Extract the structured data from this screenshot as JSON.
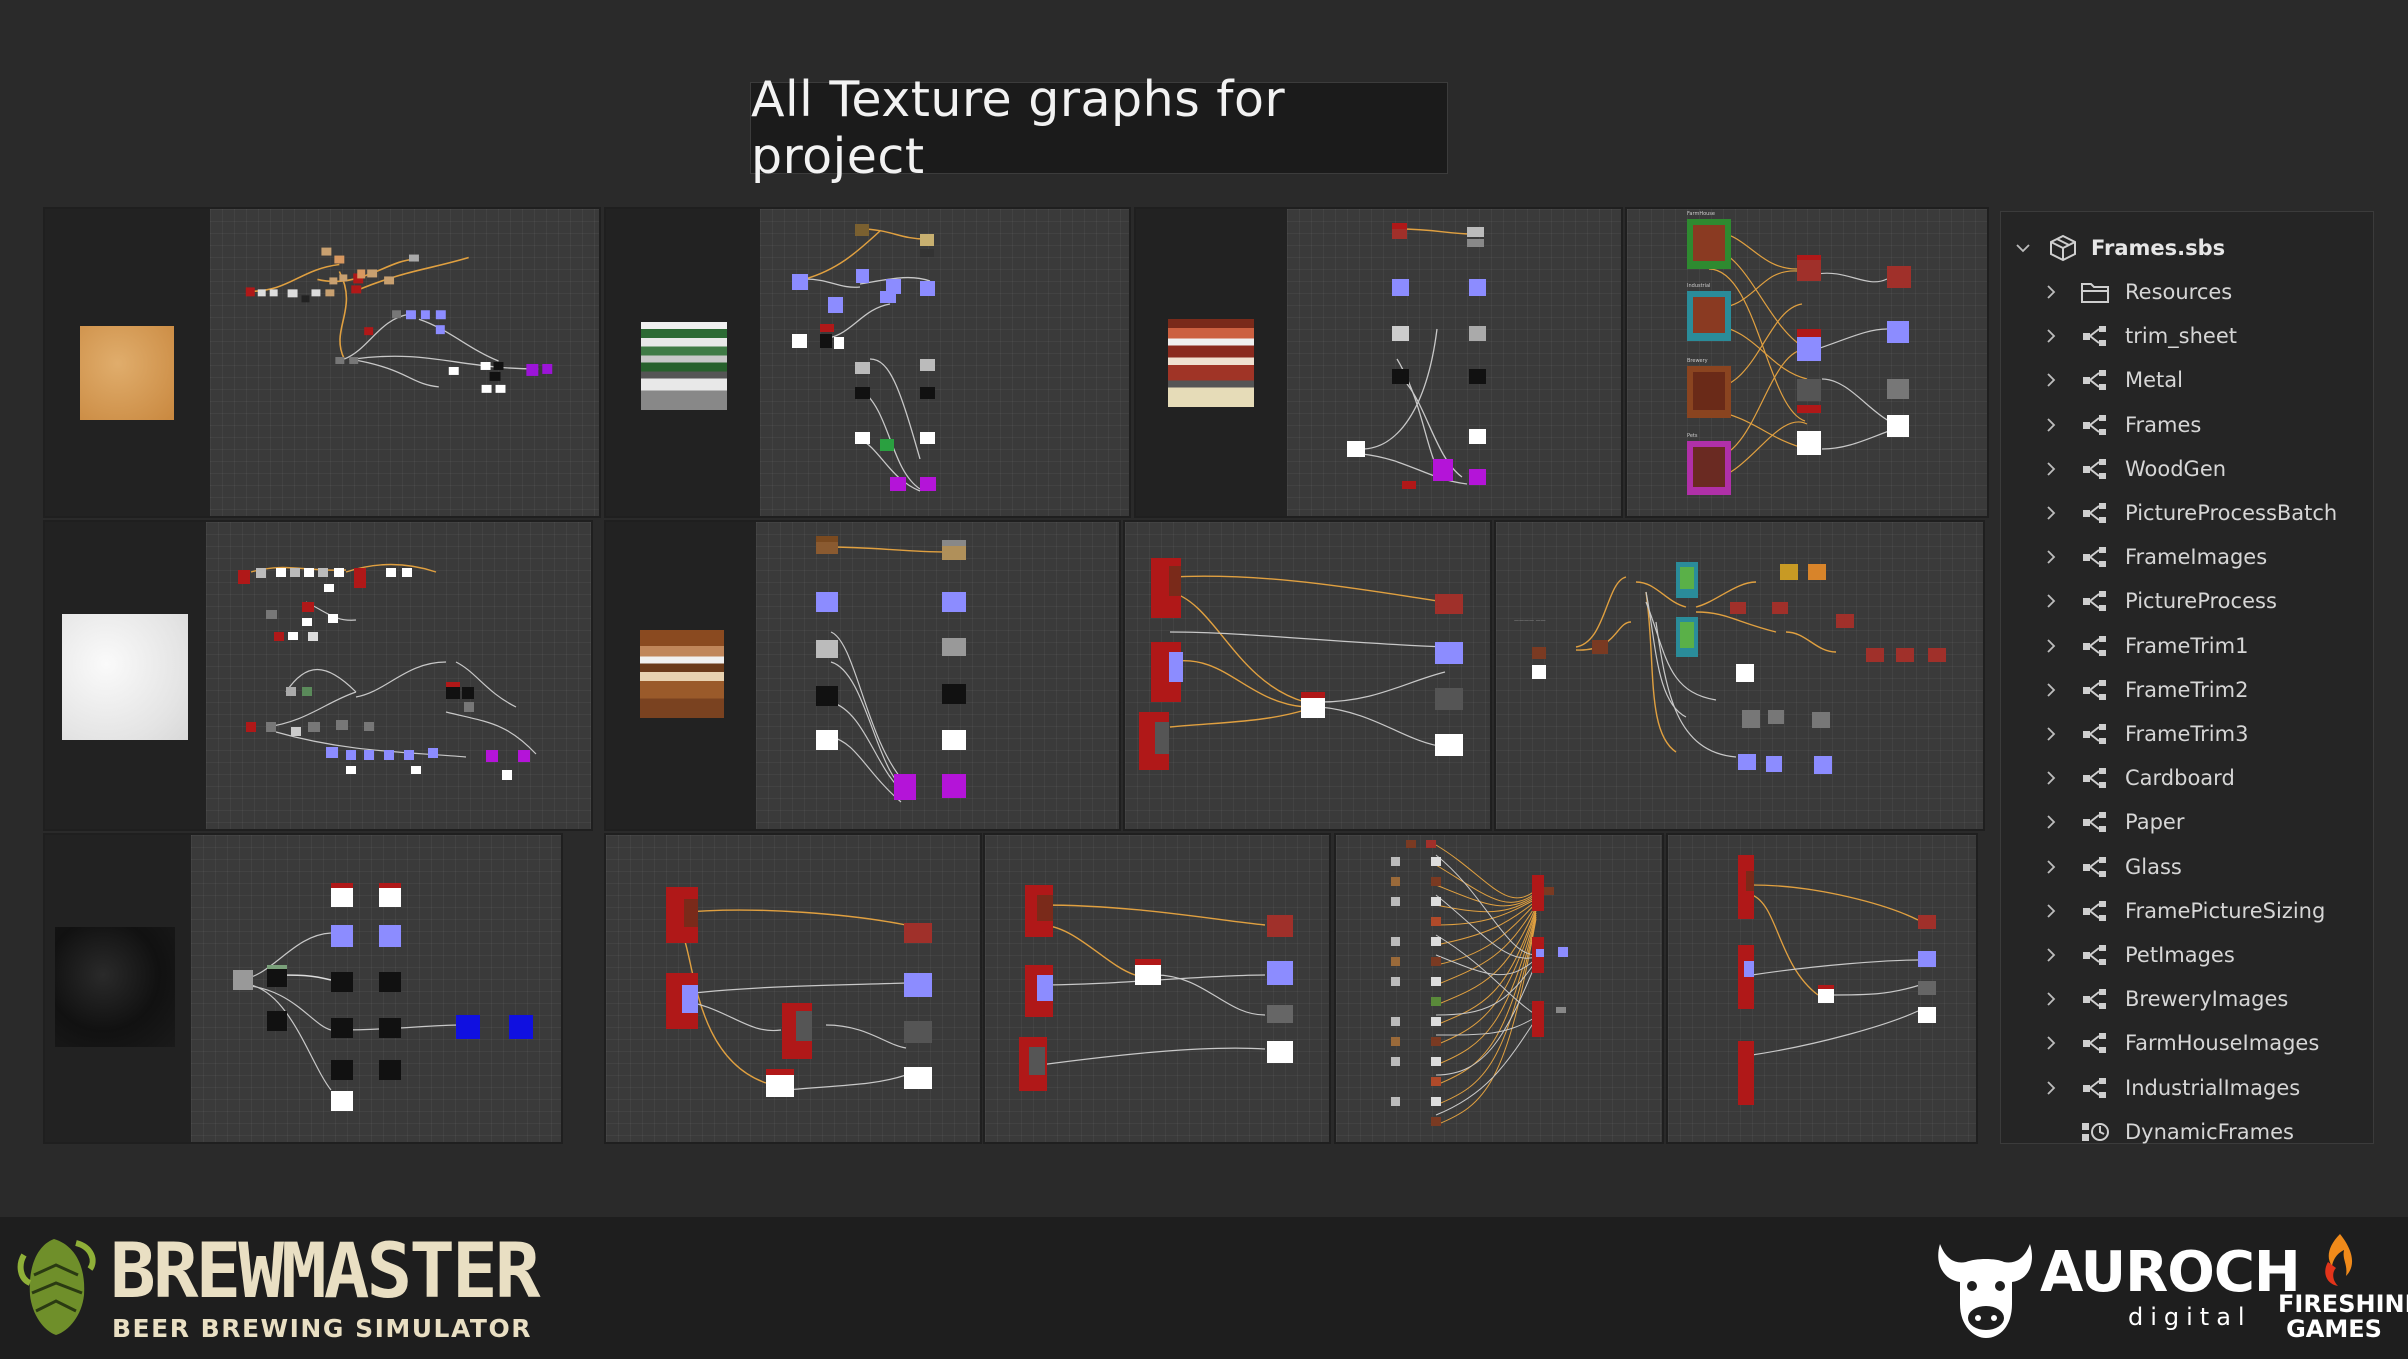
{
  "page": {
    "title": "All Texture graphs for project"
  },
  "tree": {
    "root_label": "Frames.sbs",
    "items": [
      {
        "label": "Resources",
        "icon": "folder-icon"
      },
      {
        "label": "trim_sheet",
        "icon": "graph-icon"
      },
      {
        "label": "Metal",
        "icon": "graph-icon"
      },
      {
        "label": "Frames",
        "icon": "graph-icon"
      },
      {
        "label": "WoodGen",
        "icon": "graph-icon"
      },
      {
        "label": "PictureProcessBatch",
        "icon": "graph-icon"
      },
      {
        "label": "FrameImages",
        "icon": "graph-icon"
      },
      {
        "label": "PictureProcess",
        "icon": "graph-icon"
      },
      {
        "label": "FrameTrim1",
        "icon": "graph-icon"
      },
      {
        "label": "FrameTrim2",
        "icon": "graph-icon"
      },
      {
        "label": "FrameTrim3",
        "icon": "graph-icon"
      },
      {
        "label": "Cardboard",
        "icon": "graph-icon"
      },
      {
        "label": "Paper",
        "icon": "graph-icon"
      },
      {
        "label": "Glass",
        "icon": "graph-icon"
      },
      {
        "label": "FramePictureSizing",
        "icon": "graph-icon"
      },
      {
        "label": "PetImages",
        "icon": "graph-icon"
      },
      {
        "label": "BreweryImages",
        "icon": "graph-icon"
      },
      {
        "label": "FarmHouseImages",
        "icon": "graph-icon"
      },
      {
        "label": "IndustrialImages",
        "icon": "graph-icon"
      },
      {
        "label": "DynamicFrames",
        "icon": "function-graph-icon"
      }
    ]
  },
  "footer": {
    "brand_name": "BREWMASTER",
    "brand_subtitle": "BEER BREWING SIMULATOR",
    "publisher_name": "AUROCH",
    "publisher_sub": "digital",
    "partner_name": "FIRESHINE GAMES"
  },
  "colors": {
    "background": "#2a2a2a",
    "graph_bg": "#3a3a3a",
    "link_orange": "#e0a040",
    "node_red": "#b01818",
    "node_purple": "#7b78f0",
    "node_magenta": "#b414d8",
    "node_blue": "#1010e0"
  }
}
